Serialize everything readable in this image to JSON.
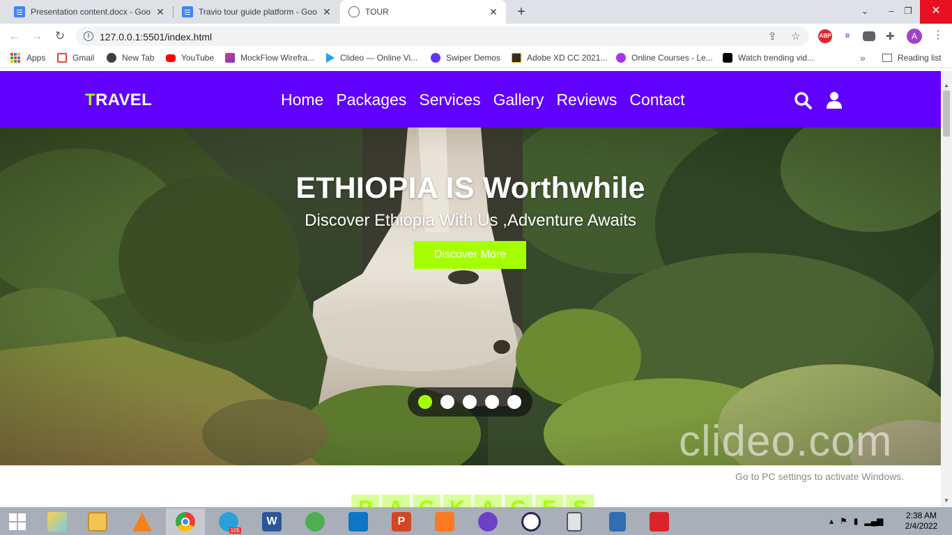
{
  "browser": {
    "tabs": [
      {
        "title": "Presentation content.docx - Goo",
        "icon": "google-docs-icon",
        "active": false
      },
      {
        "title": "Travio tour guide platform - Goo",
        "icon": "google-docs-icon",
        "active": false
      },
      {
        "title": "TOUR",
        "icon": "globe-icon",
        "active": true
      }
    ],
    "new_tab_label": "+",
    "url": "127.0.0.1:5501/index.html",
    "profile_initial": "A",
    "extensions": [
      "ABP",
      "B"
    ],
    "bookmarks": [
      {
        "label": "Apps",
        "icon": "apps-grid-icon"
      },
      {
        "label": "Gmail",
        "icon": "gmail-icon"
      },
      {
        "label": "New Tab",
        "icon": "globe-icon"
      },
      {
        "label": "YouTube",
        "icon": "youtube-icon"
      },
      {
        "label": "MockFlow Wirefra...",
        "icon": "mockflow-icon"
      },
      {
        "label": "Clideo — Online Vi...",
        "icon": "clideo-icon"
      },
      {
        "label": "Swiper Demos",
        "icon": "swiper-icon"
      },
      {
        "label": "Adobe XD CC 2021...",
        "icon": "getintopc-icon"
      },
      {
        "label": "Online Courses - Le...",
        "icon": "udemy-icon"
      },
      {
        "label": "Watch trending vid...",
        "icon": "tiktok-icon"
      }
    ],
    "bookmarks_overflow": "»",
    "reading_list_label": "Reading list"
  },
  "site": {
    "logo_first_letter": "T",
    "logo_rest": "RAVEL",
    "nav": [
      "Home",
      "Packages",
      "Services",
      "Gallery",
      "Reviews",
      "Contact"
    ],
    "header_icons": [
      "search-icon",
      "user-icon"
    ],
    "colors": {
      "header_bg": "#6000ff",
      "accent": "#a6ff00"
    }
  },
  "hero": {
    "title": "ETHIOPIA IS Worthwhile",
    "subtitle": "Discover Ethiopia With Us ,Adventure Awaits",
    "cta_label": "Discover More",
    "slide_count": 5,
    "active_slide": 1,
    "watermark": "clideo.com"
  },
  "overlay": {
    "activate_windows": "Go to PC settings to activate Windows."
  },
  "packages_heading_letters": [
    "P",
    "A",
    "C",
    "K",
    "A",
    "G",
    "E",
    "S"
  ],
  "taskbar": {
    "apps": [
      "windows-start-icon",
      "file-explorer-icon",
      "files-icon",
      "vlc-icon",
      "chrome-icon",
      "telegram-icon",
      "word-icon",
      "send-app-icon",
      "vscode-icon",
      "powerpoint-icon",
      "xampp-icon",
      "github-desktop-icon",
      "eclipse-icon",
      "calculator-icon",
      "notepad-icon",
      "acrobat-icon"
    ],
    "telegram_badge": "105",
    "clock_time": "2:38 AM",
    "clock_date": "2/4/2022"
  }
}
